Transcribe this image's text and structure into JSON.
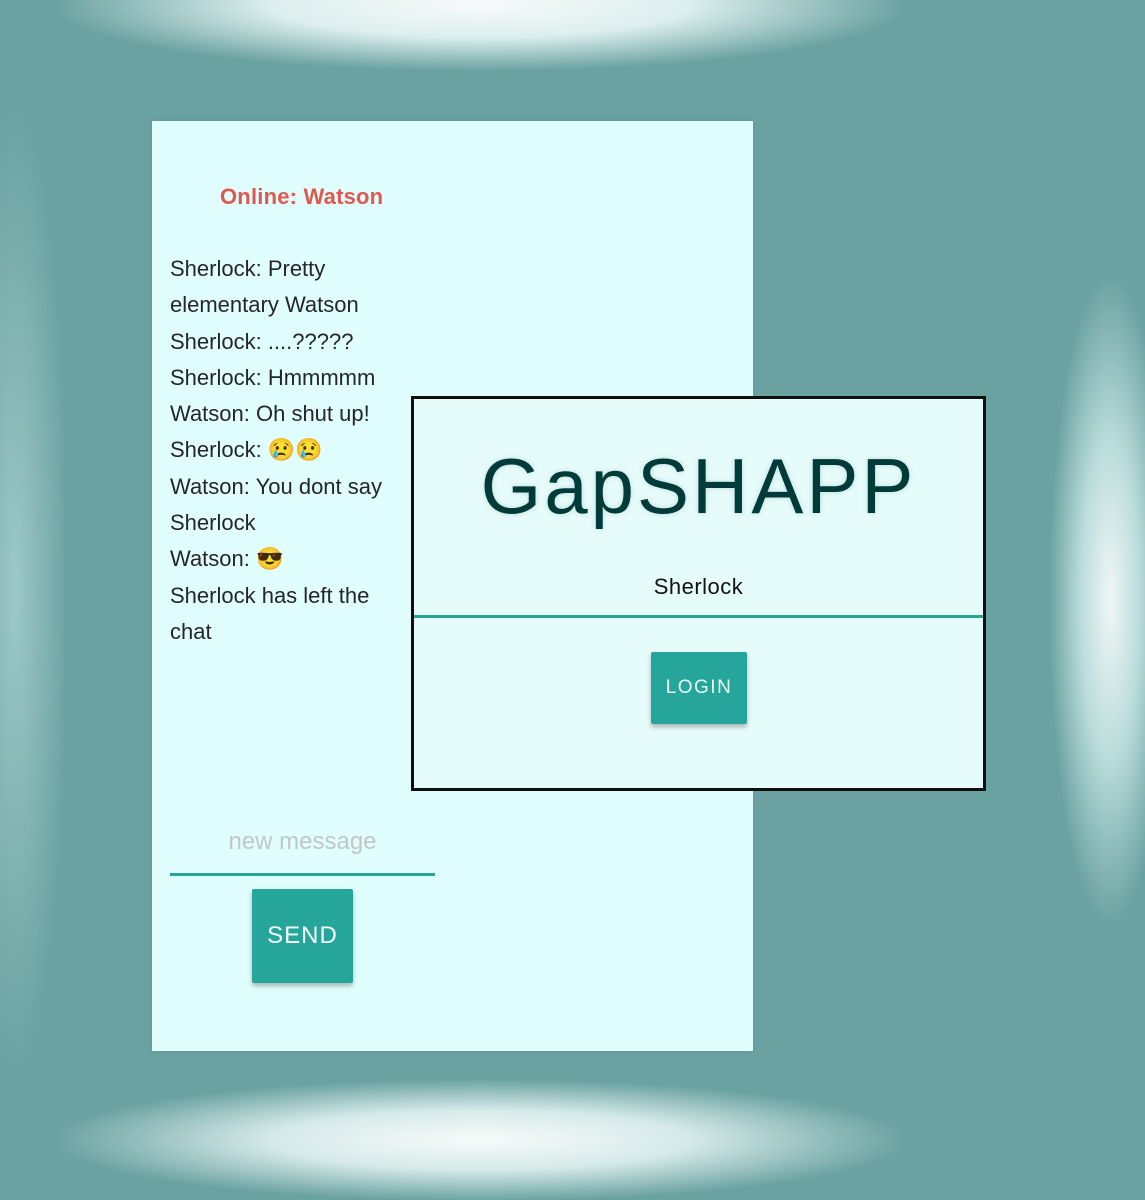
{
  "chat": {
    "online_status": "Online: Watson",
    "messages": [
      "Sherlock: Pretty elementary Watson",
      "Sherlock: ....?????",
      "Sherlock: Hmmmmm",
      "Watson: Oh shut up!",
      "Sherlock: 😢😢",
      "Watson: You dont say Sherlock",
      "Watson: 😎",
      "Sherlock has left the chat"
    ],
    "message_placeholder": "new message",
    "send_label": "SEND"
  },
  "login": {
    "app_title": "GapSHAPP",
    "username_value": "Sherlock",
    "login_label": "LOGIN"
  },
  "colors": {
    "background": "#6aa2a1",
    "panel": "#e0fefd",
    "accent": "#26a69a",
    "online_status": "#e1574e",
    "title": "#003b3a"
  }
}
